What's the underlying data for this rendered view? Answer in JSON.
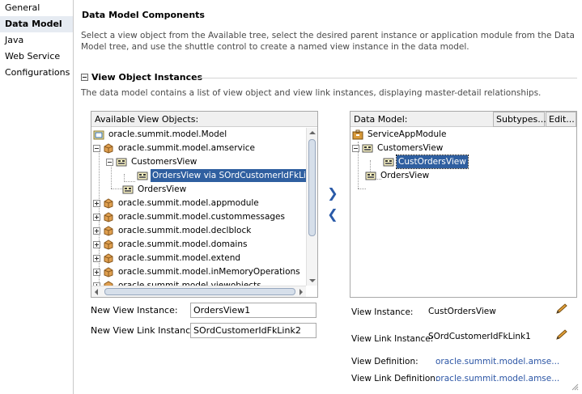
{
  "nav": {
    "items": [
      "General",
      "Data Model",
      "Java",
      "Web Service",
      "Configurations"
    ],
    "selected_index": 1
  },
  "header": {
    "title": "Data Model Components",
    "description": "Select a view object from the Available tree, select the desired parent instance or application module from the Data Model tree, and use the shuttle control to create a named view instance in the data model."
  },
  "section": {
    "title": "View Object Instances",
    "description": "The data model contains a list of view object and view link instances, displaying master-detail relationships."
  },
  "available": {
    "header": "Available View Objects:",
    "items": [
      "oracle.summit.model.Model",
      "oracle.summit.model.amservice",
      "CustomersView",
      "OrdersView via SOrdCustomerIdFkLink",
      "OrdersView",
      "oracle.summit.model.appmodule",
      "oracle.summit.model.custommessages",
      "oracle.summit.model.declblock",
      "oracle.summit.model.domains",
      "oracle.summit.model.extend",
      "oracle.summit.model.inMemoryOperations",
      "oracle.summit.model.viewobjects"
    ]
  },
  "datamodel": {
    "header": "Data Model:",
    "subtypes_label": "Subtypes...",
    "edit_label": "Edit...",
    "items": [
      "ServiceAppModule",
      "CustomersView",
      "CustOrdersView",
      "OrdersView"
    ]
  },
  "shuttle": {
    "add": "❯",
    "remove": "❮"
  },
  "fields": {
    "new_view_instance_label": "New View Instance:",
    "new_view_instance_value": "OrdersView1",
    "new_view_link_instance_label": "New View Link Instance:",
    "new_view_link_instance_value": "SOrdCustomerIdFkLink2"
  },
  "props": {
    "view_instance_label": "View Instance:",
    "view_instance_value": "CustOrdersView",
    "view_link_instance_label": "View Link Instance:",
    "view_link_instance_value": "SOrdCustomerIdFkLink1",
    "view_definition_label": "View Definition:",
    "view_definition_value": "oracle.summit.model.amse...",
    "view_link_definition_label": "View Link Definition:",
    "view_link_definition_value": "oracle.summit.model.amse..."
  },
  "icons": {
    "package": "package-icon",
    "view_object": "view-object-icon",
    "view_link": "view-link-icon",
    "app_module": "app-module-icon",
    "pencil": "pencil-icon"
  },
  "colors": {
    "selection": "#2f5fa0",
    "link": "#2b55a5",
    "nav_selected": "#e6ebf2"
  }
}
